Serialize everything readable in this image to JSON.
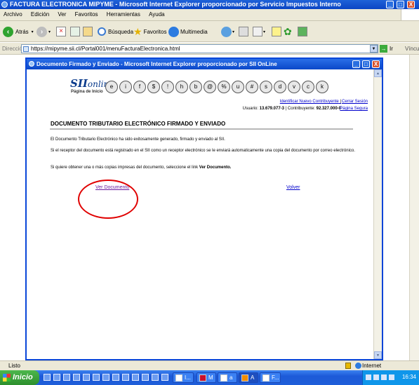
{
  "window": {
    "title": "FACTURA ELECTRONICA MIPYME - Microsoft Internet Explorer proporcionado por Servicio Impuestos Interno",
    "btn_min": "_",
    "btn_max": "□",
    "btn_close": "X"
  },
  "menu": [
    "Archivo",
    "Edición",
    "Ver",
    "Favoritos",
    "Herramientas",
    "Ayuda"
  ],
  "toolbar": {
    "back_label": "Atrás",
    "search_label": "Búsqueda",
    "favorites_label": "Favoritos",
    "multimedia_label": "Multimedia"
  },
  "address": {
    "label": "Dirección",
    "url": "https://mipyme.sii.cl/Portal001/menuFacturaElectronica.html",
    "go_label": "Ir",
    "links_label": "Vínculos"
  },
  "popup": {
    "title": "Documento Firmado y Enviado - Microsoft Internet Explorer proporcionado por SII OnLine",
    "logo_sii": "SII",
    "logo_online": "online",
    "logo_sub": "Página de Inicio",
    "service_icons": [
      "e",
      "i",
      "f",
      "$",
      "!",
      "h",
      "b",
      "@",
      "%",
      "u",
      "#",
      "s",
      "d",
      "v",
      "c",
      "k"
    ],
    "identify_link": "Identificar Nuevo Contribuyente",
    "link_separator": "|",
    "logout_link": "Cerrar Sesión",
    "user_label": "Usuario:",
    "user_value": "13.679.077-3",
    "taxpayer_label": "| Contribuyente:",
    "taxpayer_value": "92.327.000-0",
    "secure_link": "Página Segura",
    "heading": "DOCUMENTO TRIBUTARIO ELECTRÓNICO FIRMADO Y ENVIADO",
    "para1": "El Documento Tributario Electrónico ha sido exitosamente generado, firmado y enviado al SII.",
    "para2": "Si el receptor del documento está registrado en el SII como un receptor electrónico se le enviará automaticamente una copia del documento por correo electrónico.",
    "para3_prefix": "Si quiere obtener una o más copias impresas del documento, seleccione el link",
    "para3_bold": "Ver Documento.",
    "view_doc_link": "Ver Documento",
    "back_link": "Volver"
  },
  "status": {
    "left": "Listo",
    "zone": "Internet"
  },
  "taskbar": {
    "start_label": "Inicio",
    "tasks": [
      "I...",
      "M",
      "a",
      "A",
      "F..."
    ],
    "clock": "16:34"
  },
  "colors": {
    "title_blue": "#0b45c4",
    "link_visited": "#6a1d9e",
    "link_blue": "#0000cc",
    "highlight_red": "#e00000"
  }
}
